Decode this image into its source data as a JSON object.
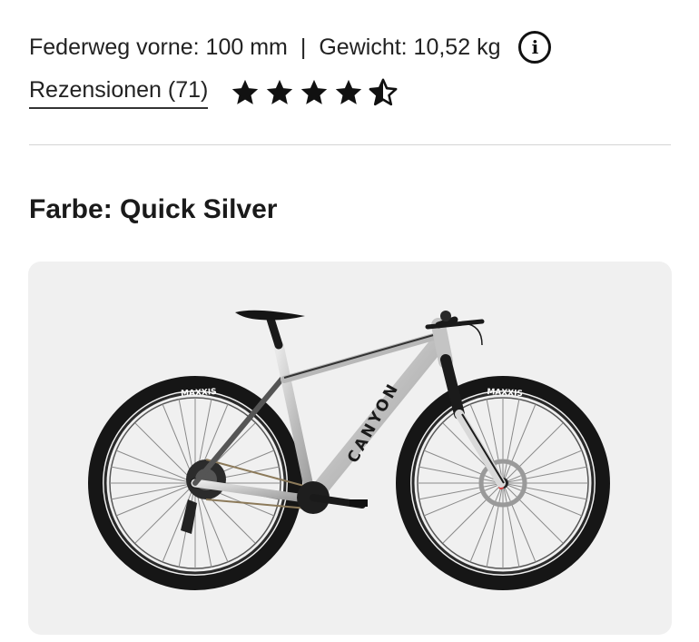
{
  "specs": {
    "suspension": "Federweg vorne: 100 mm",
    "separator": "|",
    "weight": "Gewicht: 10,52 kg",
    "info_icon": "info-icon"
  },
  "reviews": {
    "link_text": "Rezensionen (71)",
    "rating": 4.5,
    "max_rating": 5
  },
  "color": {
    "label": "Farbe: Quick Silver"
  },
  "product_image": {
    "tire_brand": "MAXXIS",
    "frame_brand": "CANYON",
    "colors": {
      "frame": "#c9c9c9",
      "dark": "#1c1c1c",
      "rotor_accent": "#d23a3a"
    }
  }
}
